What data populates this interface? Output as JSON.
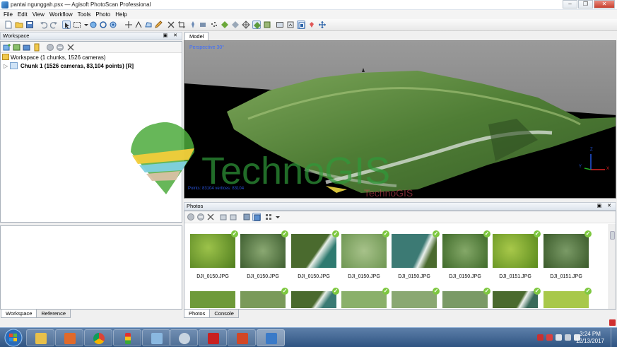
{
  "window": {
    "title": "pantai ngunggah.psx — Agisoft PhotoScan Professional"
  },
  "menu": [
    "File",
    "Edit",
    "View",
    "Workflow",
    "Tools",
    "Photo",
    "Help"
  ],
  "workspace": {
    "title": "Workspace",
    "root_label": "Workspace (1 chunks, 1526 cameras)",
    "chunk_label": "Chunk 1 (1526 cameras, 83,104 points) [R]"
  },
  "bottom_tabs": [
    "Workspace",
    "Reference"
  ],
  "model": {
    "tab": "Model",
    "view_label": "Perspective 30°",
    "status": "Points: 83104 vertices: 83104",
    "axes": {
      "x": "X",
      "y": "Y",
      "z": "Z"
    }
  },
  "photos": {
    "title": "Photos",
    "tabs": [
      "Photos",
      "Console"
    ],
    "items": [
      {
        "label": "DJI_0150.JPG"
      },
      {
        "label": "DJI_0150.JPG"
      },
      {
        "label": "DJI_0150.JPG"
      },
      {
        "label": "DJI_0150.JPG"
      },
      {
        "label": "DJI_0150.JPG"
      },
      {
        "label": "DJI_0150.JPG"
      },
      {
        "label": "DJI_0151.JPG"
      },
      {
        "label": "DJI_0151.JPG"
      }
    ]
  },
  "watermark": {
    "brand": "TechnoGIS",
    "sub": "TechnoGIS"
  },
  "taskbar": {
    "time": "3:24 PM",
    "date": "12/13/2017"
  },
  "colors": {
    "accent": "#2f5482",
    "check": "#7ec840",
    "watermark": "#2f9a3a"
  }
}
